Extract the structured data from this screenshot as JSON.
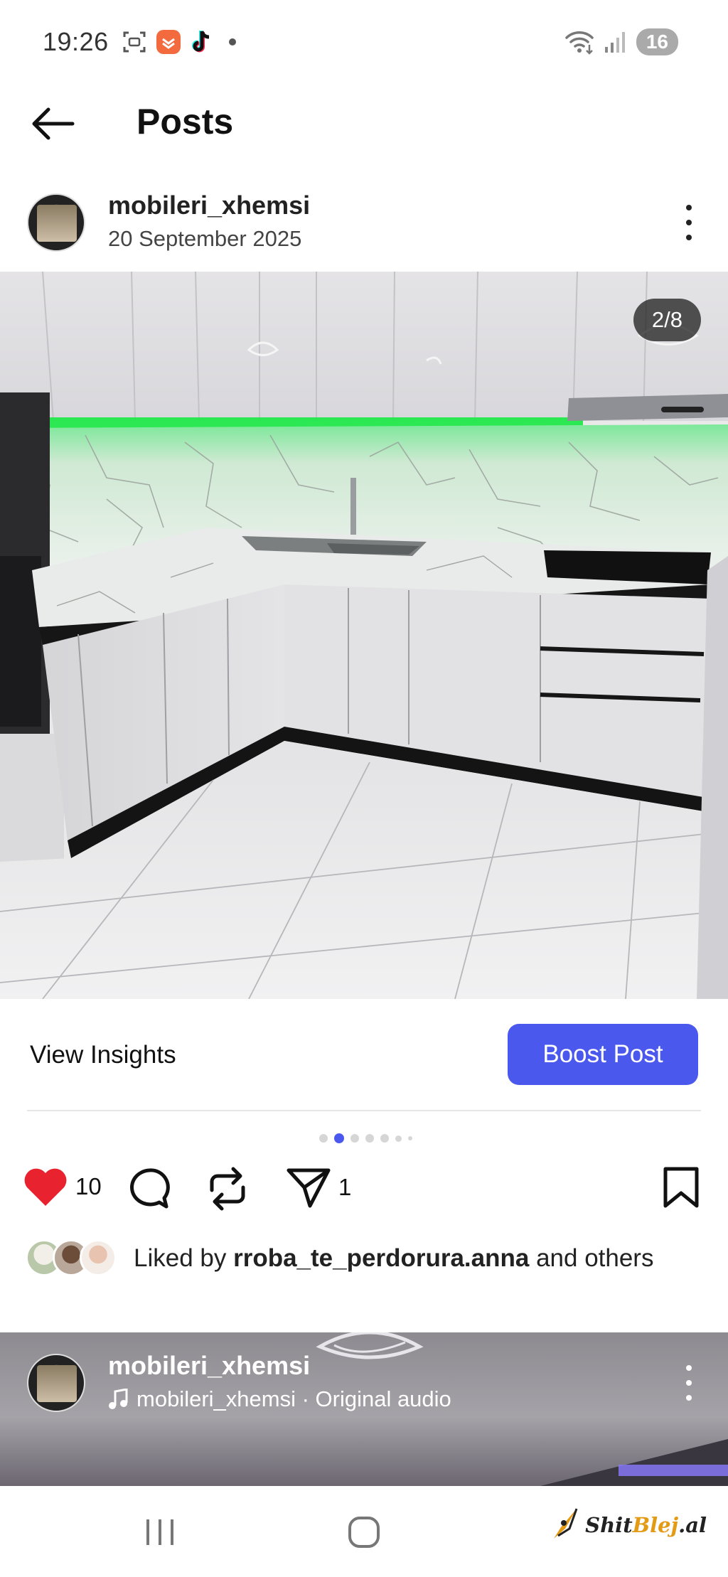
{
  "status_bar": {
    "time": "19:26",
    "battery": "16",
    "icons": [
      "screenshot-icon",
      "app-notification-icon",
      "tiktok-icon",
      "wifi-icon",
      "signal-icon"
    ]
  },
  "header": {
    "title": "Posts",
    "back_icon": "arrow-left-icon"
  },
  "post": {
    "username": "mobileri_xhemsi",
    "date": "20 September 2025",
    "image_counter": "2/8",
    "image_desc_icon": "kitchen-photo",
    "insights_label": "View Insights",
    "boost_label": "Boost Post",
    "carousel": {
      "total": 8,
      "active": 2
    },
    "likes": "10",
    "shares": "1",
    "liked_by_prefix": "Liked by ",
    "liked_by_user": "rroba_te_perdorura.anna",
    "liked_by_suffix": " and others"
  },
  "next_post": {
    "username": "mobileri_xhemsi",
    "audio": "mobileri_xhemsi · Original audio"
  },
  "watermark": {
    "part1": "Shit",
    "part2": "Blej",
    "part3": ".al"
  },
  "colors": {
    "accent": "#4b58ee",
    "like_red": "#e8222e",
    "led_green": "#22e84a"
  }
}
